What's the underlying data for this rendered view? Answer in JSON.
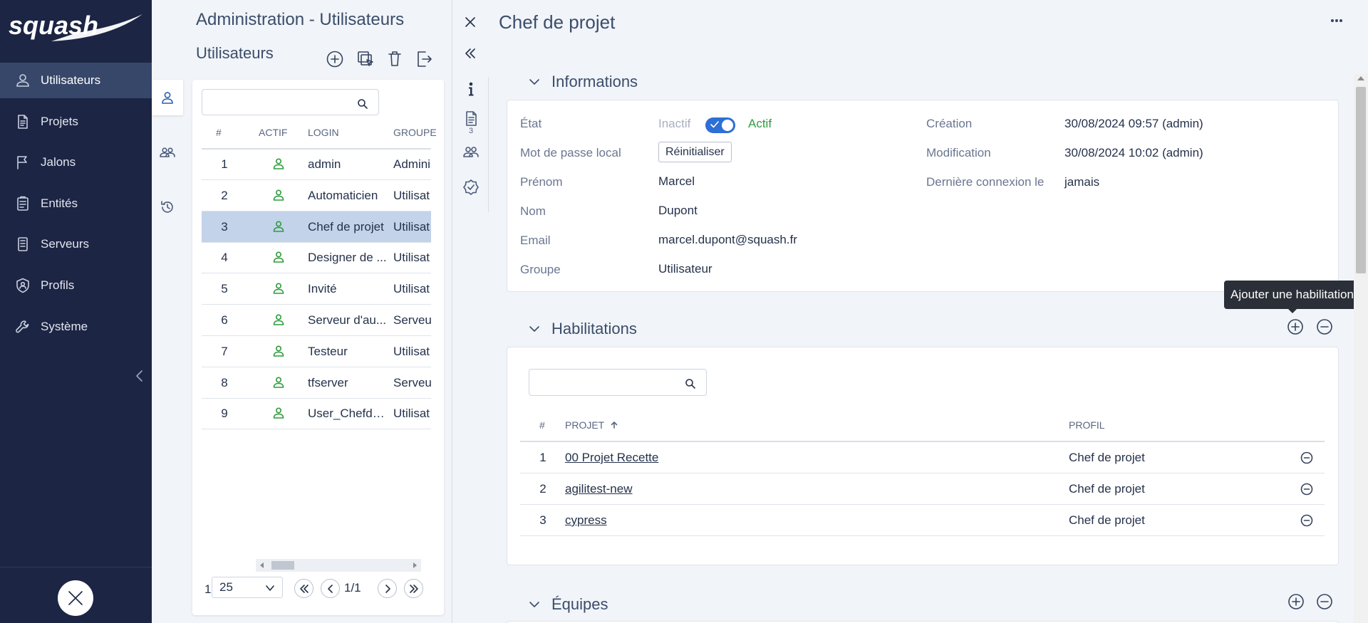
{
  "nav": {
    "logo_text": "squash",
    "items": [
      {
        "label": "Utilisateurs",
        "icon": "user-icon"
      },
      {
        "label": "Projets",
        "icon": "document-icon"
      },
      {
        "label": "Jalons",
        "icon": "flag-icon"
      },
      {
        "label": "Entités",
        "icon": "clipboard-icon"
      },
      {
        "label": "Serveurs",
        "icon": "server-icon"
      },
      {
        "label": "Profils",
        "icon": "shield-user-icon"
      },
      {
        "label": "Système",
        "icon": "wrench-icon"
      }
    ],
    "active_index": 0
  },
  "list": {
    "admin_title": "Administration - Utilisateurs",
    "title": "Utilisateurs",
    "search_placeholder": "",
    "columns": [
      "#",
      "ACTIF",
      "LOGIN",
      "GROUPE"
    ],
    "rows": [
      {
        "num": "1",
        "login": "admin",
        "group": "Admini"
      },
      {
        "num": "2",
        "login": "Automaticien",
        "group": "Utilisat"
      },
      {
        "num": "3",
        "login": "Chef de projet",
        "group": "Utilisat"
      },
      {
        "num": "4",
        "login": "Designer de ...",
        "group": "Utilisat"
      },
      {
        "num": "5",
        "login": "Invité",
        "group": "Utilisat"
      },
      {
        "num": "6",
        "login": "Serveur d'au...",
        "group": "Serveu"
      },
      {
        "num": "7",
        "login": "Testeur",
        "group": "Utilisat"
      },
      {
        "num": "8",
        "login": "tfserver",
        "group": "Serveu"
      },
      {
        "num": "9",
        "login": "User_Chefde...",
        "group": "Utilisat"
      }
    ],
    "selected_index": 2,
    "pager": {
      "first": "1",
      "page_size": "25",
      "page": "1/1"
    }
  },
  "detail": {
    "title": "Chef de projet",
    "rail_count": "3",
    "info": {
      "heading": "Informations",
      "state_label": "État",
      "state_off": "Inactif",
      "state_on": "Actif",
      "active": true,
      "password_label": "Mot de passe local",
      "reset_label": "Réinitialiser",
      "firstname_label": "Prénom",
      "firstname": "Marcel",
      "lastname_label": "Nom",
      "lastname": "Dupont",
      "email_label": "Email",
      "email": "marcel.dupont@squash.fr",
      "group_label": "Groupe",
      "group": "Utilisateur",
      "created_label": "Création",
      "created": "30/08/2024 09:57 (admin)",
      "modified_label": "Modification",
      "modified": "30/08/2024 10:02 (admin)",
      "lastlogin_label": "Dernière connexion le",
      "lastlogin": "jamais"
    },
    "habilitations": {
      "heading": "Habilitations",
      "tooltip": "Ajouter une habilitation",
      "search_placeholder": "",
      "columns": {
        "num": "#",
        "project": "PROJET",
        "profile": "PROFIL"
      },
      "rows": [
        {
          "num": "1",
          "project": "00 Projet Recette",
          "profile": "Chef de projet"
        },
        {
          "num": "2",
          "project": "agilitest-new",
          "profile": "Chef de projet"
        },
        {
          "num": "3",
          "project": "cypress",
          "profile": "Chef de projet"
        }
      ]
    },
    "teams": {
      "heading": "Équipes"
    }
  },
  "colors": {
    "nav_bg": "#1c2544",
    "nav_active": "#37476a",
    "accent": "#2d6fd6",
    "active_green": "#2e9c3c",
    "selected_row": "#c3d3ea"
  }
}
